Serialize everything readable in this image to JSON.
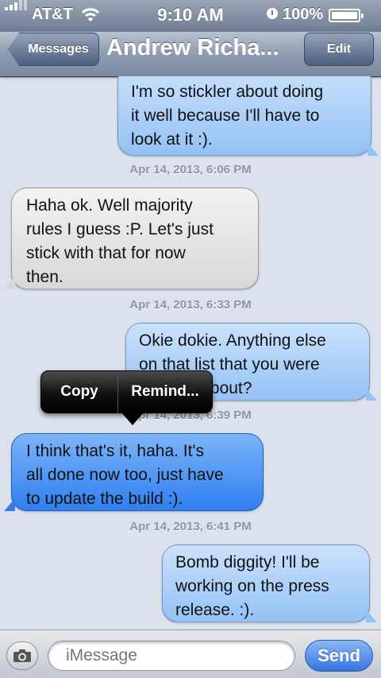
{
  "status_bar": {
    "carrier": "AT&T",
    "time": "9:10 AM",
    "battery": "100%"
  },
  "nav": {
    "back_label": "Messages",
    "title": "Andrew Richa...",
    "edit_label": "Edit"
  },
  "messages": [
    {
      "direction": "outgoing",
      "text": "I'm so stickler about doing it well because I'll have to look at it :)."
    },
    {
      "timestamp": "Apr 14, 2013, 6:06 PM"
    },
    {
      "direction": "incoming",
      "text": "Haha ok. Well majority rules I guess :P. Let's just stick with that for now then."
    },
    {
      "timestamp": "Apr 14, 2013, 6:33 PM"
    },
    {
      "direction": "outgoing",
      "text": "Okie dokie. Anything else on that list that you were thinking about?"
    },
    {
      "timestamp": "Apr 14, 2013, 6:39 PM"
    },
    {
      "direction": "incoming",
      "selected": true,
      "text": "I think that's it, haha. It's all done now too, just have to update the build :)."
    },
    {
      "timestamp": "Apr 14, 2013, 6:41 PM"
    },
    {
      "direction": "outgoing",
      "text": "Bomb diggity! I'll be working on the press release. :)."
    }
  ],
  "bubbles": {
    "b1_lines": [
      "I'm so stickler about doing",
      "it well because I'll have to",
      "look at it :)."
    ],
    "b2_lines": [
      "Haha ok. Well majority",
      "rules I guess :P. Let's just",
      "stick with that for now",
      "then."
    ],
    "b3_lines": [
      "Okie dokie. Anything else",
      "on that list that you were",
      "thinking about?"
    ],
    "b4_lines": [
      "I think that's it, haha. It's",
      "all done now too, just have",
      "to update the build :)."
    ],
    "b5_lines": [
      "Bomb diggity! I'll be",
      "working on the press",
      "release. :)."
    ]
  },
  "timestamps": [
    "Apr 14, 2013, 6:06 PM",
    "Apr 14, 2013, 6:33 PM",
    "Apr 14, 2013, 6:39 PM",
    "Apr 14, 2013, 6:41 PM"
  ],
  "context_menu": {
    "copy_label": "Copy",
    "remind_label": "Remind..."
  },
  "composer": {
    "placeholder": "iMessage",
    "send_label": "Send",
    "camera_icon": "camera-icon"
  },
  "colors": {
    "outgoing_bubble": "#94c2f5",
    "incoming_bubble": "#d8d8d8",
    "selected_bubble": "#2f7ff0",
    "background": "#dbe2ed"
  }
}
